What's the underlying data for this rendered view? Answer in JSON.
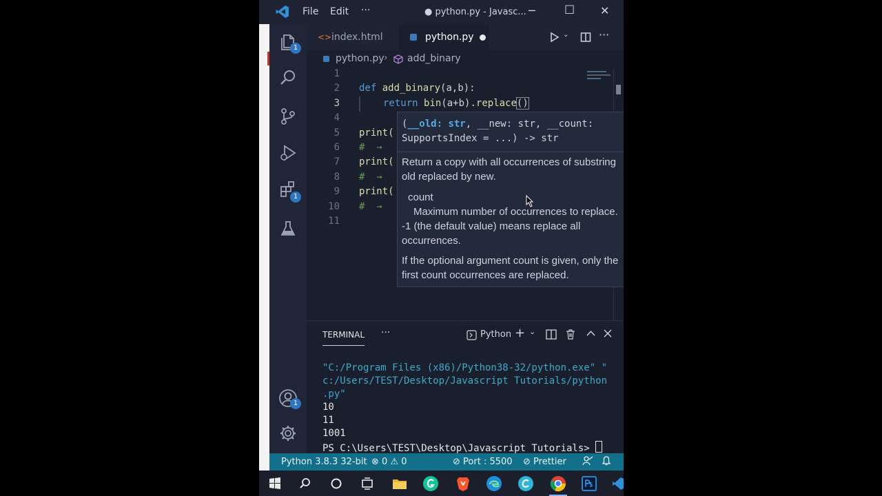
{
  "titlebar": {
    "menu_file": "File",
    "menu_edit": "Edit",
    "menu_more": "···",
    "window_title": "● python.py - Javasc...",
    "minimize": "─",
    "maximize": "☐",
    "close": "✕"
  },
  "activity": {
    "explorer_badge": "1",
    "extensions_badge": "1",
    "accounts_badge": "1"
  },
  "tabs": [
    {
      "label": "index.html",
      "icon": "html-icon",
      "active": false
    },
    {
      "label": "python.py",
      "icon": "python-icon",
      "active": true,
      "modified": true
    }
  ],
  "breadcrumb": {
    "file": "python.py",
    "symbol": "add_binary"
  },
  "editor": {
    "line_numbers": [
      "1",
      "2",
      "3",
      "4",
      "5",
      "6",
      "7",
      "8",
      "9",
      "10",
      "11"
    ],
    "lines": [
      "",
      "def add_binary(a,b):",
      "    return bin(a+b).replace()",
      "",
      "print(",
      "#  →",
      "print(",
      "#  →",
      "print(",
      "#  →",
      ""
    ],
    "line2_def": "def",
    "line2_name": "add_binary",
    "line2_rest": "(a,b):",
    "line3_return": "return",
    "line3_call": "bin",
    "line3_args": "(a+b).",
    "line3_method": "replace",
    "line3_paren": "()",
    "print_kw": "print(",
    "comment_arrow": "#  →"
  },
  "hover": {
    "signature_old": "__old: str",
    "signature_line1_pre": "(",
    "signature_line1_rest": ", __new: str, __count:",
    "signature_line2": "SupportsIndex = ...) -> str",
    "description": "Return a copy with all occurrences of substring old replaced by new.",
    "param_name": "count",
    "param_desc": "Maximum number of occurrences to replace. -1 (the default value) means replace all occurrences.",
    "note": "If the optional argument count is given, only the first count occurrences are replaced."
  },
  "terminal": {
    "tab_label": "TERMINAL",
    "more": "···",
    "shell_label": "Python",
    "lines": [
      "\"C:/Program Files (x86)/Python38-32/python.exe\" \"",
      "c:/Users/TEST/Desktop/Javascript Tutorials/python",
      ".py\"",
      "10",
      "11",
      "1001",
      "PS C:\\Users\\TEST\\Desktop\\Javascript Tutorials> "
    ]
  },
  "statusbar": {
    "interpreter": "Python 3.8.3 32-bit",
    "errors": "0",
    "warnings": "0",
    "port": "Port : 5500",
    "prettier": "Prettier"
  },
  "colors": {
    "statusbar": "#13708a",
    "accent": "#2f74c0",
    "keyword": "#569cd6",
    "function": "#dcdcaa",
    "terminal_path": "#3fa9c7"
  }
}
